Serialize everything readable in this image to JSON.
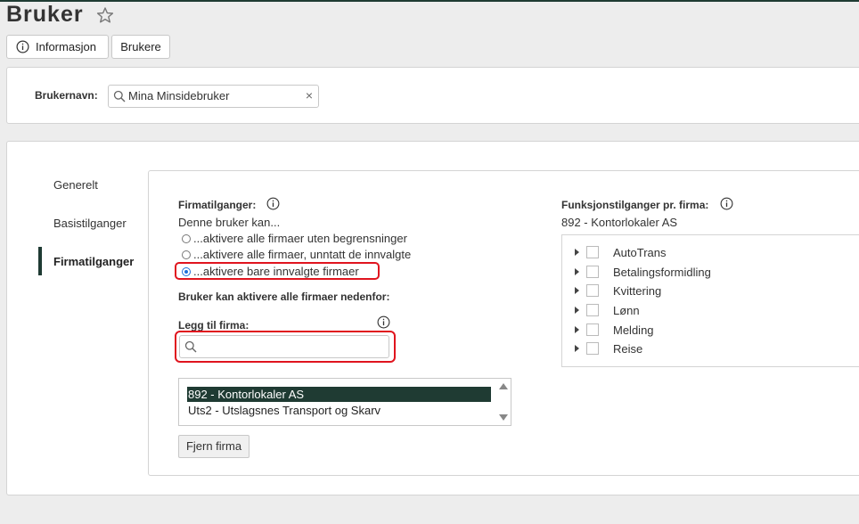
{
  "page": {
    "title": "Bruker"
  },
  "tabs": {
    "info_label": "Informasjon",
    "users_label": "Brukere"
  },
  "user_field": {
    "label": "Brukernavn:",
    "value": "Mina Minsidebruker",
    "clear_symbol": "×"
  },
  "nav": {
    "items": [
      "Generelt",
      "Basistilganger",
      "Firmatilganger"
    ],
    "active": "Firmatilganger"
  },
  "firm_access": {
    "heading": "Firmatilganger:",
    "subtitle": "Denne bruker kan...",
    "options": [
      "...aktivere alle firmaer uten begrensninger",
      "...aktivere alle firmaer, unntatt de innvalgte",
      "...aktivere bare innvalgte firmaer"
    ],
    "selected_index": 2,
    "list_heading": "Bruker kan aktivere alle firmaer nedenfor:",
    "add_label": "Legg til firma:",
    "search_placeholder": "",
    "firms": [
      "892 - Kontorlokaler AS",
      "Uts2 - Utslagsnes Transport og Skarv"
    ],
    "selected_firm": "892 - Kontorlokaler AS",
    "remove_button": "Fjern firma"
  },
  "function_access": {
    "heading": "Funksjonstilganger pr. firma:",
    "firm": "892 - Kontorlokaler AS",
    "items": [
      "AutoTrans",
      "Betalingsformidling",
      "Kvittering",
      "Lønn",
      "Melding",
      "Reise"
    ]
  },
  "colors": {
    "accent": "#1f3b33",
    "highlight": "#e0141e",
    "radio": "#1e6fd9"
  },
  "icons": {
    "star": "star-icon",
    "info": "info-icon",
    "search": "search-icon"
  }
}
